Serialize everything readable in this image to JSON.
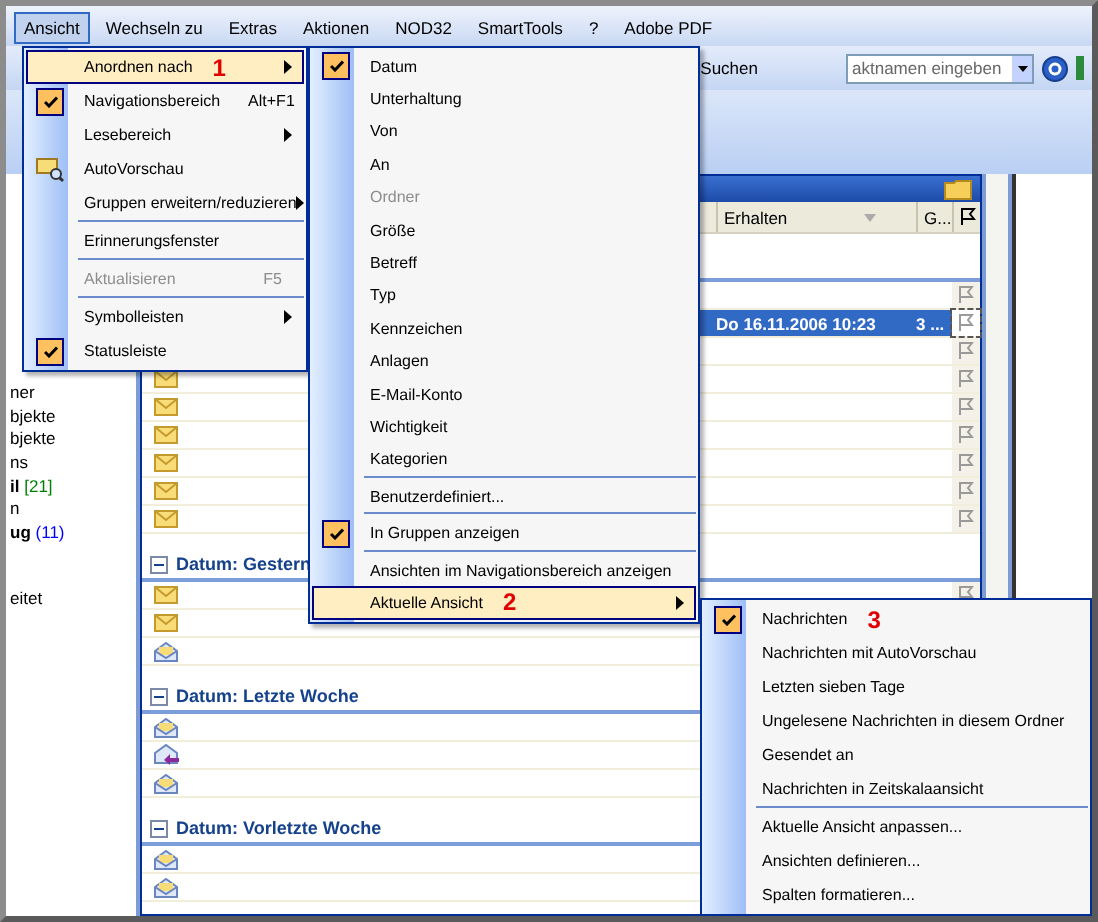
{
  "menubar": [
    {
      "label": "Ansicht",
      "selected": true
    },
    {
      "label": "Wechseln zu",
      "selected": false
    },
    {
      "label": "Extras",
      "selected": false
    },
    {
      "label": "Aktionen",
      "selected": false
    },
    {
      "label": "NOD32",
      "selected": false
    },
    {
      "label": "SmartTools",
      "selected": false
    },
    {
      "label": "?",
      "selected": false
    },
    {
      "label": "Adobe PDF",
      "selected": false
    }
  ],
  "toolbar": {
    "search_label": "Suchen",
    "contact_field": {
      "placeholder": "aktnamen eingeben"
    }
  },
  "nav_pane": {
    "sections": [
      {
        "items": [
          {
            "label": "ner",
            "bold": false
          },
          {
            "label": "bjekte",
            "bold": false
          },
          {
            "label": "bjekte",
            "bold": false
          },
          {
            "label": "ns",
            "bold": false
          },
          {
            "label": "il",
            "bold": true,
            "count": "[21]",
            "color": "#008000"
          },
          {
            "label": "n",
            "bold": false
          },
          {
            "label": "ug",
            "bold": true,
            "count": "(11)",
            "color": "#0000ff"
          }
        ]
      },
      {
        "items": [
          {
            "label": "eitet",
            "bold": false
          }
        ]
      }
    ]
  },
  "mail_list": {
    "columns": [
      {
        "label": "Erhalten",
        "kind": "sort"
      },
      {
        "label": "G...",
        "kind": "plain"
      },
      {
        "kind": "flag"
      }
    ],
    "rows": [
      {
        "kind": "group"
      },
      {
        "kind": "mail",
        "flag": true,
        "selected": false
      },
      {
        "kind": "mail",
        "flag": true,
        "selected": true,
        "received": "Do 16.11.2006 10:23",
        "size": "3 ..."
      },
      {
        "kind": "mail",
        "flag": true,
        "selected": false
      },
      {
        "kind": "mail",
        "read": false,
        "replied": false,
        "flag": true,
        "selected": false
      },
      {
        "kind": "mail",
        "read": false,
        "replied": false,
        "flag": true,
        "selected": false
      },
      {
        "kind": "mail",
        "read": false,
        "replied": false,
        "flag": true,
        "selected": false
      },
      {
        "kind": "mail",
        "read": false,
        "replied": false,
        "flag": true,
        "selected": false
      },
      {
        "kind": "mail",
        "read": false,
        "replied": false,
        "flag": true,
        "selected": false
      },
      {
        "kind": "mail",
        "read": false,
        "replied": false,
        "flag": true,
        "selected": false
      },
      {
        "kind": "group",
        "label": "Datum: Gestern"
      },
      {
        "kind": "mail",
        "read": false,
        "replied": false,
        "flag": true,
        "selected": false
      },
      {
        "kind": "mail",
        "read": false,
        "replied": false,
        "selected": false
      },
      {
        "kind": "mail",
        "read": true,
        "replied": false,
        "selected": false
      },
      {
        "kind": "group",
        "label": "Datum: Letzte Woche"
      },
      {
        "kind": "mail",
        "read": true,
        "replied": false,
        "selected": false
      },
      {
        "kind": "mail",
        "read": true,
        "replied": true,
        "selected": false
      },
      {
        "kind": "mail",
        "read": true,
        "replied": false,
        "selected": false
      },
      {
        "kind": "group",
        "label": "Datum: Vorletzte Woche"
      },
      {
        "kind": "mail",
        "read": true,
        "replied": false,
        "selected": false
      },
      {
        "kind": "mail",
        "read": true,
        "replied": false,
        "selected": false
      }
    ]
  },
  "menus": [
    {
      "items": [
        {
          "kind": "item",
          "label": "Anordnen nach",
          "marker": "1",
          "submenu": true,
          "selected": true
        },
        {
          "kind": "item",
          "label": "Navigationsbereich",
          "shortcut": "Alt+F1",
          "checked": true,
          "selected": false
        },
        {
          "kind": "item",
          "label": "Lesebereich",
          "submenu": true,
          "selected": false
        },
        {
          "kind": "item",
          "label": "AutoVorschau",
          "icon": true,
          "selected": false
        },
        {
          "kind": "item",
          "label": "Gruppen erweitern/reduzieren",
          "submenu": true,
          "selected": false
        },
        {
          "kind": "separator"
        },
        {
          "kind": "item",
          "label": "Erinnerungsfenster",
          "selected": false
        },
        {
          "kind": "separator"
        },
        {
          "kind": "item",
          "label": "Aktualisieren",
          "shortcut": "F5",
          "disabled": true,
          "selected": false
        },
        {
          "kind": "separator"
        },
        {
          "kind": "item",
          "label": "Symbolleisten",
          "submenu": true,
          "selected": false
        },
        {
          "kind": "item",
          "label": "Statusleiste",
          "checked": true,
          "selected": false
        }
      ]
    },
    {
      "items": [
        {
          "kind": "item",
          "label": "Datum",
          "checked": true,
          "selected": false
        },
        {
          "kind": "item",
          "label": "Unterhaltung",
          "selected": false
        },
        {
          "kind": "item",
          "label": "Von",
          "selected": false
        },
        {
          "kind": "item",
          "label": "An",
          "selected": false
        },
        {
          "kind": "item",
          "label": "Ordner",
          "disabled": true,
          "selected": false
        },
        {
          "kind": "item",
          "label": "Größe",
          "selected": false
        },
        {
          "kind": "item",
          "label": "Betreff",
          "selected": false
        },
        {
          "kind": "item",
          "label": "Typ",
          "selected": false
        },
        {
          "kind": "item",
          "label": "Kennzeichen",
          "selected": false
        },
        {
          "kind": "item",
          "label": "Anlagen",
          "selected": false
        },
        {
          "kind": "item",
          "label": "E-Mail-Konto",
          "selected": false
        },
        {
          "kind": "item",
          "label": "Wichtigkeit",
          "selected": false
        },
        {
          "kind": "item",
          "label": "Kategorien",
          "selected": false
        },
        {
          "kind": "separator"
        },
        {
          "kind": "item",
          "label": "Benutzerdefiniert...",
          "selected": false
        },
        {
          "kind": "separator"
        },
        {
          "kind": "item",
          "label": "In Gruppen anzeigen",
          "checked": true,
          "selected": false
        },
        {
          "kind": "separator"
        },
        {
          "kind": "item",
          "label": "Ansichten im Navigationsbereich anzeigen",
          "selected": false
        },
        {
          "kind": "item",
          "label": "Aktuelle Ansicht",
          "marker": "2",
          "submenu": true,
          "selected": true
        }
      ]
    },
    {
      "items": [
        {
          "kind": "item",
          "label": "Nachrichten",
          "marker": "3",
          "checked": true,
          "selected": false
        },
        {
          "kind": "item",
          "label": "Nachrichten mit AutoVorschau",
          "selected": false
        },
        {
          "kind": "item",
          "label": "Letzten sieben Tage",
          "selected": false
        },
        {
          "kind": "item",
          "label": "Ungelesene Nachrichten in diesem Ordner",
          "selected": false
        },
        {
          "kind": "item",
          "label": "Gesendet an",
          "selected": false
        },
        {
          "kind": "item",
          "label": "Nachrichten in Zeitskalaansicht",
          "selected": false
        },
        {
          "kind": "separator"
        },
        {
          "kind": "item",
          "label": "Aktuelle Ansicht anpassen...",
          "selected": false
        },
        {
          "kind": "item",
          "label": "Ansichten definieren...",
          "selected": false
        },
        {
          "kind": "item",
          "label": "Spalten formatieren...",
          "selected": false
        }
      ]
    }
  ]
}
